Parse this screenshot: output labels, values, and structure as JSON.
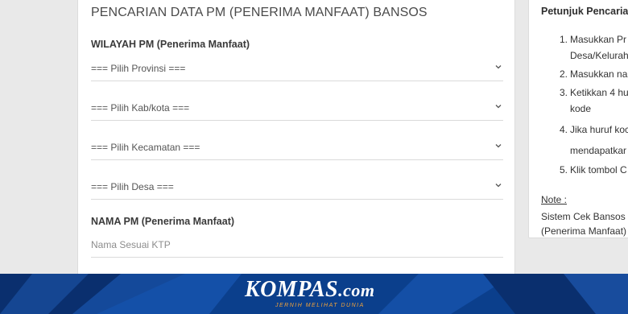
{
  "form": {
    "title": "PENCARIAN DATA PM (PENERIMA MANFAAT) BANSOS",
    "wilayah_label": "WILAYAH PM (Penerima Manfaat)",
    "selects": [
      {
        "value": "=== Pilih Provinsi ==="
      },
      {
        "value": "=== Pilih Kab/kota ==="
      },
      {
        "value": "=== Pilih Kecamatan ==="
      },
      {
        "value": "=== Pilih Desa ==="
      }
    ],
    "nama_label": "NAMA PM (Penerima Manfaat)",
    "nama_placeholder": "Nama Sesuai KTP"
  },
  "sidebar": {
    "title": "Petunjuk Pencarian",
    "steps": [
      {
        "num": "1.",
        "lines": [
          "Masukkan Pr",
          "Desa/Kelurah"
        ]
      },
      {
        "num": "2.",
        "lines": [
          "Masukkan na"
        ]
      },
      {
        "num": "3.",
        "lines": [
          "Ketikkan 4 hu",
          "kode"
        ]
      },
      {
        "num": "4.",
        "lines": [
          "Jika huruf koc",
          "mendapatkar"
        ]
      },
      {
        "num": "5.",
        "lines": [
          "Klik tombol C"
        ]
      }
    ],
    "note_label": "Note :",
    "note_lines": [
      "Sistem Cek Bansos",
      "(Penerima Manfaat)"
    ]
  },
  "banner": {
    "brand": "KOMPAS",
    "tld": ".com",
    "tagline": "JERNIH MELIHAT DUNIA",
    "background_color": "#0b3f8c",
    "tagline_color": "#f2a33a"
  }
}
